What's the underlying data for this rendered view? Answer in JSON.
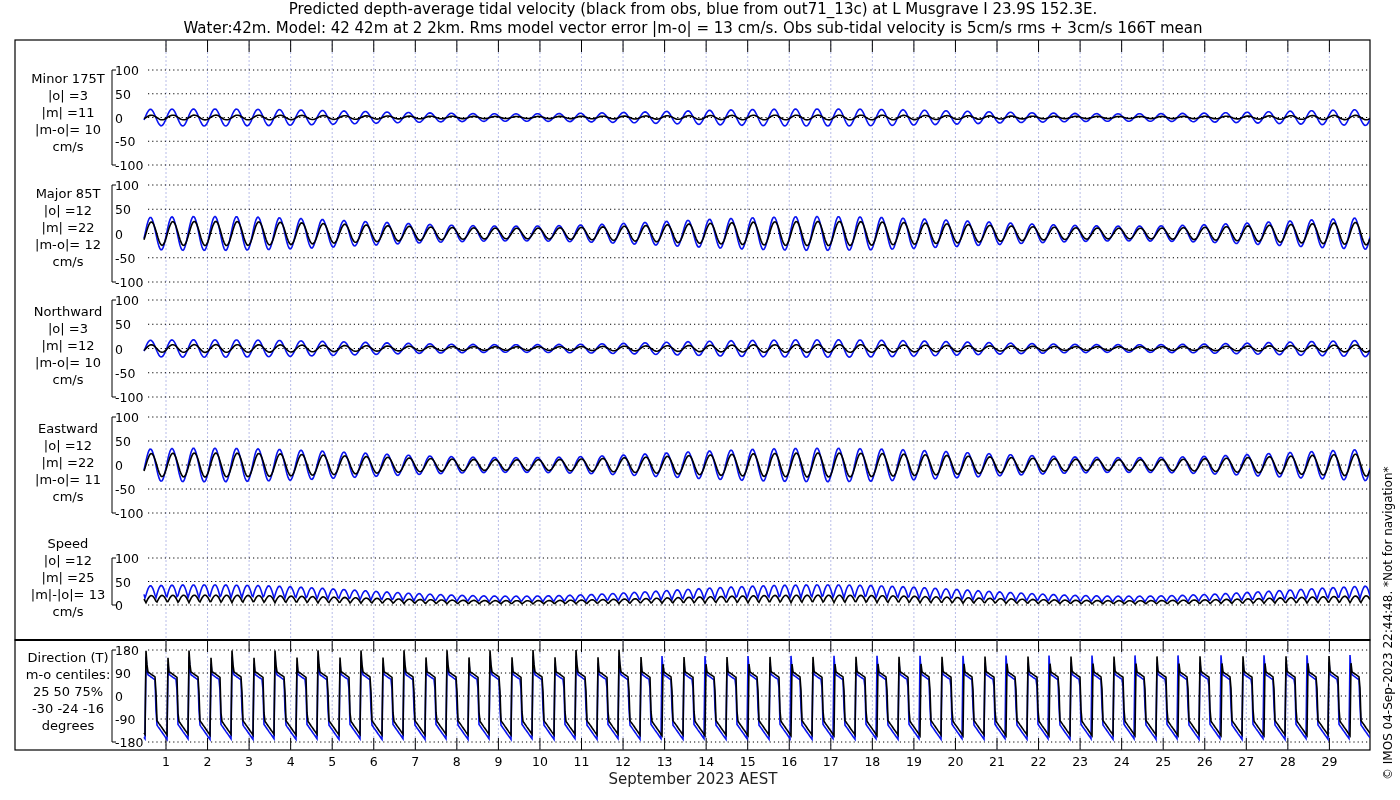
{
  "title": [
    "Predicted depth-average tidal velocity (black from obs, blue from out71_13c) at L Musgrave I 23.9S 152.3E.",
    "Water:42m. Model: 42 42m at 2 2km. Rms model vector error |m-o| = 13 cm/s. Obs sub-tidal velocity is 5cm/s rms + 3cm/s 166T mean"
  ],
  "panels": [
    {
      "kind": "velocity",
      "label": [
        "Minor 175T",
        "|o| =3",
        "|m| =11",
        "|m-o|= 10",
        "cm/s"
      ],
      "yticks": [
        "100",
        "50",
        "0",
        "-50",
        "-100"
      ]
    },
    {
      "kind": "velocity",
      "label": [
        "Major 85T",
        "|o| =12",
        "|m| =22",
        "|m-o|= 12",
        "cm/s"
      ],
      "yticks": [
        "100",
        "50",
        "0",
        "-50",
        "-100"
      ]
    },
    {
      "kind": "velocity",
      "label": [
        "Northward",
        "|o| =3",
        "|m| =12",
        "|m-o|= 10",
        "cm/s"
      ],
      "yticks": [
        "100",
        "50",
        "0",
        "-50",
        "-100"
      ]
    },
    {
      "kind": "velocity",
      "label": [
        "Eastward",
        "|o| =12",
        "|m| =22",
        "|m-o|= 11",
        "cm/s"
      ],
      "yticks": [
        "100",
        "50",
        "0",
        "-50",
        "-100"
      ]
    },
    {
      "kind": "speed",
      "label": [
        "Speed",
        "|o| =12",
        "|m| =25",
        "|m|-|o|= 13",
        "cm/s"
      ],
      "yticks": [
        "100",
        "50",
        "0"
      ]
    },
    {
      "kind": "direction",
      "label": [
        "Direction (T)",
        "m-o centiles:",
        "25  50  75%",
        "-30 -24 -16",
        "degrees"
      ],
      "yticks": [
        "180",
        "90",
        "0",
        "-90",
        "-180"
      ]
    }
  ],
  "xticks": [
    "1",
    "2",
    "3",
    "4",
    "5",
    "6",
    "7",
    "8",
    "9",
    "10",
    "11",
    "12",
    "13",
    "14",
    "15",
    "16",
    "17",
    "18",
    "19",
    "20",
    "21",
    "22",
    "23",
    "24",
    "25",
    "26",
    "27",
    "28",
    "29"
  ],
  "xlabel": "September 2023 AEST",
  "note": "© IMOS 04-Sep-2023 22:44:48. *Not for navigation*"
}
